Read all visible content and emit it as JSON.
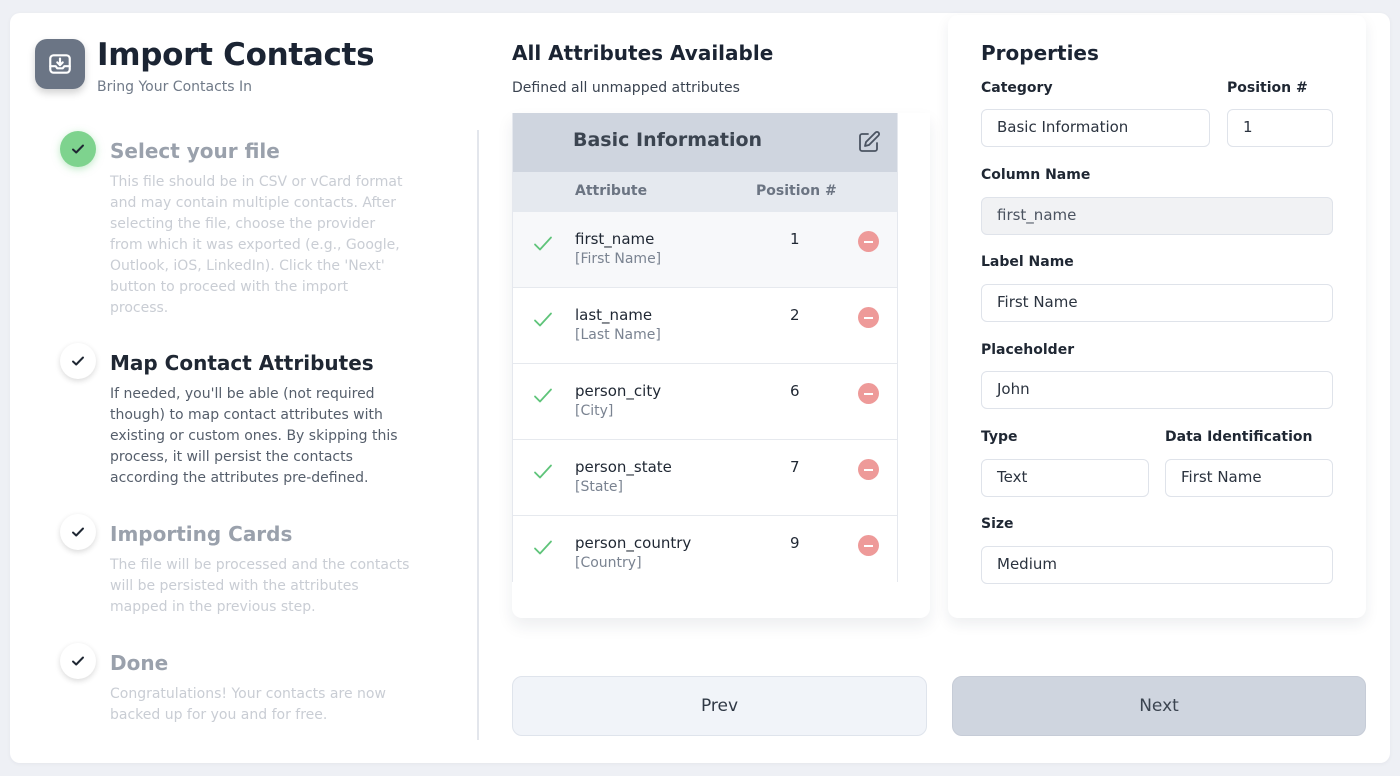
{
  "header": {
    "title": "Import Contacts",
    "subtitle": "Bring Your Contacts In",
    "icon": "download-tray-icon"
  },
  "steps": [
    {
      "title": "Select your file",
      "description": "This file should be in CSV or vCard format and may contain multiple contacts. After selecting the file, choose the provider from which it was exported (e.g., Google, Outlook, iOS, LinkedIn). Click the 'Next' button to proceed with the import process.",
      "status": "completed"
    },
    {
      "title": "Map Contact Attributes",
      "description": "If needed, you'll be able (not required though) to map contact attributes with existing or custom ones. By skipping this process, it will persist the contacts according the attributes pre-defined.",
      "status": "active"
    },
    {
      "title": "Importing Cards",
      "description": "The file will be processed and the contacts will be persisted with the attributes mapped in the previous step.",
      "status": "pending"
    },
    {
      "title": "Done",
      "description": "Congratulations! Your contacts are now backed up for you and for free.",
      "status": "pending"
    }
  ],
  "attributes_panel": {
    "title": "All Attributes Available",
    "subtitle": "Defined all unmapped attributes",
    "group_title": "Basic Information",
    "columns": {
      "attribute": "Attribute",
      "position": "Position #"
    },
    "rows": [
      {
        "attribute": "first_name",
        "label": "[First Name]",
        "position": "1"
      },
      {
        "attribute": "last_name",
        "label": "[Last Name]",
        "position": "2"
      },
      {
        "attribute": "person_city",
        "label": "[City]",
        "position": "6"
      },
      {
        "attribute": "person_state",
        "label": "[State]",
        "position": "7"
      },
      {
        "attribute": "person_country",
        "label": "[Country]",
        "position": "9"
      }
    ]
  },
  "properties": {
    "title": "Properties",
    "category_label": "Category",
    "category_value": "Basic Information",
    "position_label": "Position #",
    "position_value": "1",
    "column_name_label": "Column Name",
    "column_name_value": "first_name",
    "label_name_label": "Label Name",
    "label_name_value": "First Name",
    "placeholder_label": "Placeholder",
    "placeholder_value": "John",
    "type_label": "Type",
    "type_value": "Text",
    "data_id_label": "Data Identification",
    "data_id_value": "First Name",
    "size_label": "Size",
    "size_value": "Medium"
  },
  "buttons": {
    "prev": "Prev",
    "next": "Next"
  },
  "colors": {
    "success": "#7ed38e",
    "check_green": "#5fc47a",
    "remove_red": "#ee9a99",
    "group_header": "#cfd5df"
  }
}
